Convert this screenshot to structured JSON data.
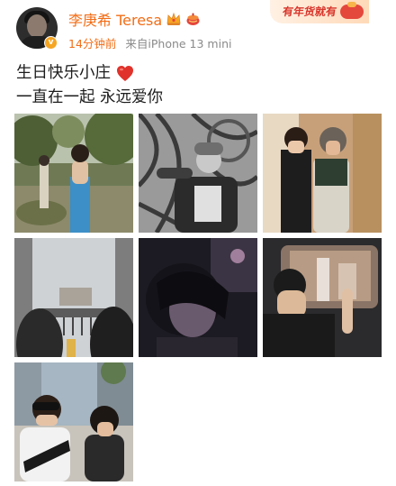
{
  "post": {
    "author": {
      "name": "李庚希 Teresa",
      "verified_badge": "v",
      "badges": [
        "crown-icon",
        "tea-icon"
      ]
    },
    "meta": {
      "time": "14分钟前",
      "source": "来自iPhone 13 mini"
    },
    "festival_banner": {
      "text": "有年货就有"
    },
    "content": {
      "line1": "生日快乐小庄",
      "line2": "一直在一起 永远爱你",
      "emoji": "heart-icon"
    },
    "photos": [
      {
        "name": "photo-1"
      },
      {
        "name": "photo-2"
      },
      {
        "name": "photo-3"
      },
      {
        "name": "photo-4"
      },
      {
        "name": "photo-5"
      },
      {
        "name": "photo-6"
      },
      {
        "name": "photo-7"
      }
    ]
  },
  "colors": {
    "accent": "#f26d16",
    "meta_text": "#8a8a8a",
    "body_text": "#1c1c1c",
    "heart": "#e0322b"
  }
}
